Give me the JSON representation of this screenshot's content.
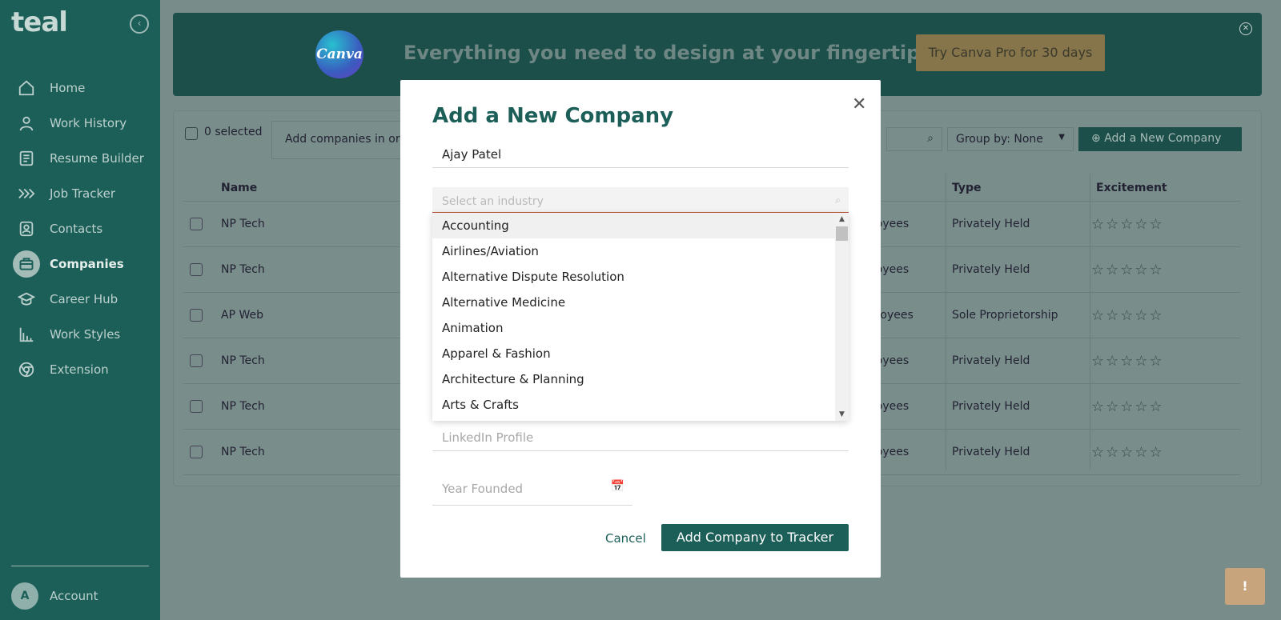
{
  "sidebar": {
    "logo": "teal",
    "collapse_icon": "chevron-left-icon",
    "items": [
      {
        "label": "Home",
        "icon": "home-icon"
      },
      {
        "label": "Work History",
        "icon": "user-icon"
      },
      {
        "label": "Resume Builder",
        "icon": "document-icon"
      },
      {
        "label": "Job Tracker",
        "icon": "chevrons-right-icon"
      },
      {
        "label": "Contacts",
        "icon": "contacts-icon"
      },
      {
        "label": "Companies",
        "icon": "briefcase-icon",
        "active": true
      },
      {
        "label": "Career Hub",
        "icon": "graduation-cap-icon"
      },
      {
        "label": "Work Styles",
        "icon": "bar-chart-icon"
      },
      {
        "label": "Extension",
        "icon": "chrome-icon"
      }
    ],
    "account": {
      "initial": "A",
      "label": "Account"
    }
  },
  "promo": {
    "brand": "Canva",
    "text": "Everything you need to design at your fingertips",
    "button": "Try Canva Pro for 30 days"
  },
  "toolbar": {
    "selected": "0 selected",
    "hint": "Add companies in or",
    "group_by": "Group by: None",
    "add_button": "Add a New Company"
  },
  "table": {
    "headers": {
      "name": "Name",
      "type": "Type",
      "excitement": "Excitement"
    },
    "rows": [
      {
        "name": "NP Tech",
        "employees": "ployees",
        "type": "Privately Held",
        "excitement": 0
      },
      {
        "name": "NP Tech",
        "employees": "ployees",
        "type": "Privately Held",
        "excitement": 0
      },
      {
        "name": "AP Web",
        "employees": "mployees",
        "type": "Sole Proprietorship",
        "excitement": 0
      },
      {
        "name": "NP Tech",
        "employees": "ployees",
        "type": "Privately Held",
        "excitement": 0
      },
      {
        "name": "NP Tech",
        "employees": "ployees",
        "type": "Privately Held",
        "excitement": 0
      },
      {
        "name": "NP Tech",
        "employees": "ployees",
        "type": "Privately Held",
        "excitement": 0
      }
    ]
  },
  "modal": {
    "title": "Add a New Company",
    "company_value": "Ajay Patel",
    "industry_placeholder": "Select an industry",
    "linkedin_placeholder": "LinkedIn Profile",
    "year_placeholder": "Year Founded",
    "cancel": "Cancel",
    "submit": "Add Company to Tracker"
  },
  "industry_options": [
    "Accounting",
    "Airlines/Aviation",
    "Alternative Dispute Resolution",
    "Alternative Medicine",
    "Animation",
    "Apparel & Fashion",
    "Architecture & Planning",
    "Arts & Crafts"
  ],
  "colors": {
    "brand": "#1c5f58",
    "accent_warning": "#b8542f",
    "promo_button": "#c8a47c"
  }
}
